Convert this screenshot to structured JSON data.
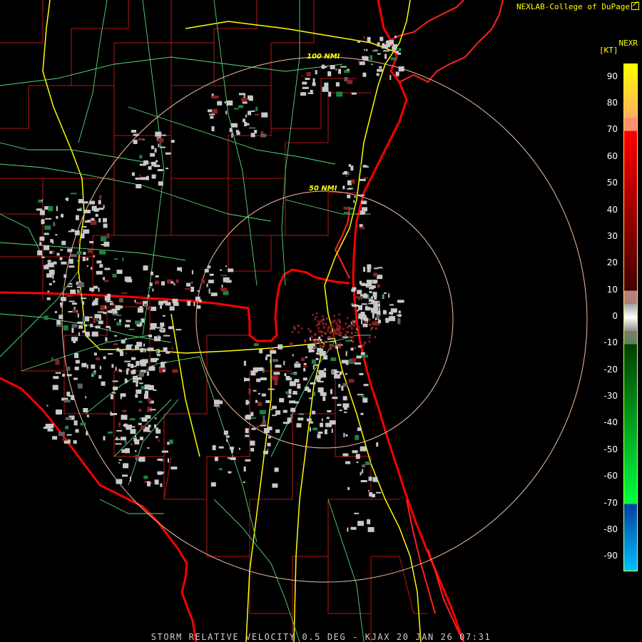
{
  "credit": "NEXLAB-College of DuPage",
  "product": "NEXR",
  "units": "[KT]",
  "range_rings": [
    "50 NMI",
    "100 NMI"
  ],
  "footer": "STORM RELATIVE VELOCITY 0.5 DEG - KJAX 20 JAN 26 07:31",
  "colors": {
    "background": "#000000",
    "coast": "#ff0000",
    "county": "#c81818",
    "highway_major": "#ffff00",
    "highway_minor": "#60e080",
    "ring": "#f0c0a0",
    "label": "#ffff00"
  },
  "scale": {
    "ticks": [
      {
        "v": 90,
        "label": "90"
      },
      {
        "v": 80,
        "label": "80"
      },
      {
        "v": 70,
        "label": "70"
      },
      {
        "v": 60,
        "label": "60"
      },
      {
        "v": 50,
        "label": "50"
      },
      {
        "v": 40,
        "label": "40"
      },
      {
        "v": 30,
        "label": "30"
      },
      {
        "v": 20,
        "label": "20"
      },
      {
        "v": 10,
        "label": "10"
      },
      {
        "v": 0,
        "label": "0"
      },
      {
        "v": -10,
        "label": "-10"
      },
      {
        "v": -20,
        "label": "-20"
      },
      {
        "v": -30,
        "label": "-30"
      },
      {
        "v": -40,
        "label": "-40"
      },
      {
        "v": -50,
        "label": "-50"
      },
      {
        "v": -60,
        "label": "-60"
      },
      {
        "v": -70,
        "label": "-70"
      },
      {
        "v": -80,
        "label": "-80"
      },
      {
        "v": -90,
        "label": "-90"
      }
    ],
    "range": [
      -95,
      95
    ],
    "bands": [
      {
        "from": 95,
        "to": 75,
        "top": "#ffff00",
        "bottom": "#ffb060"
      },
      {
        "from": 75,
        "to": 70,
        "top": "#ff9070",
        "bottom": "#ff9070"
      },
      {
        "from": 70,
        "to": 10,
        "top": "#ff0000",
        "bottom": "#400000"
      },
      {
        "from": 10,
        "to": -10,
        "top": "#c08080",
        "bottom": "#608060"
      },
      {
        "from": -10,
        "to": -70,
        "top": "#004000",
        "bottom": "#00ff40"
      },
      {
        "from": -70,
        "to": -95,
        "top": "#0040a0",
        "bottom": "#00c0ff"
      }
    ]
  }
}
